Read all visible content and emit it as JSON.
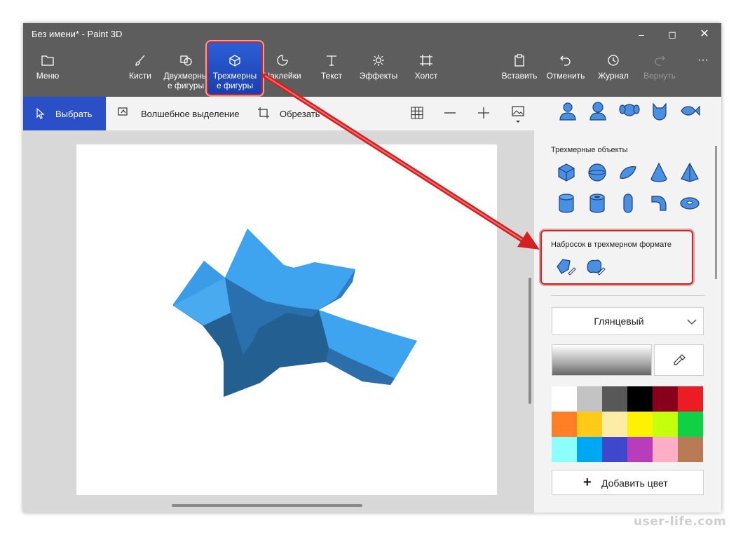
{
  "window": {
    "title": "Без имени* - Paint 3D"
  },
  "toolbar": {
    "menu": "Меню",
    "brushes": "Кисти",
    "shapes2d": [
      "Двухмерны",
      "е фигуры"
    ],
    "shapes3d": [
      "Трехмерны",
      "е фигуры"
    ],
    "stickers": "Наклейки",
    "text": "Текст",
    "effects": "Эффекты",
    "canvas": "Холст",
    "paste": "Вставить",
    "undo": "Отменить",
    "history": "Журнал",
    "redo": "Вернуть"
  },
  "subbar": {
    "select": "Выбрать",
    "magic_select": "Волшебное выделение",
    "crop": "Обрезать"
  },
  "panel": {
    "objects_title": "Трехмерные объекты",
    "sketch_title": "Набросок в трехмерном формате",
    "material": "Глянцевый",
    "add_color": "Добавить цвет"
  },
  "colors": {
    "accent": "#2a4fc6",
    "highlight_border": "#c62828",
    "palette": [
      "#ffffff",
      "#c3c3c3",
      "#585858",
      "#000000",
      "#88001b",
      "#ec1c24",
      "#ff7f27",
      "#ffca18",
      "#fdeca6",
      "#fff200",
      "#c4ff0e",
      "#0ed145",
      "#8cfffb",
      "#00a8f3",
      "#3f48cc",
      "#b83dba",
      "#ffaec8",
      "#b97a56"
    ]
  },
  "watermark": "user-life.com"
}
